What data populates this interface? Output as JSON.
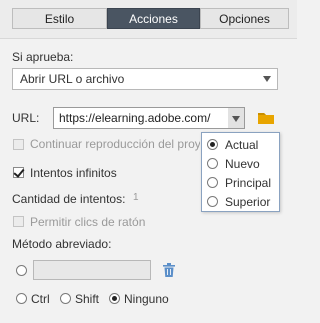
{
  "tabs": [
    {
      "label": "Estilo",
      "active": false
    },
    {
      "label": "Acciones",
      "active": true
    },
    {
      "label": "Opciones",
      "active": false
    }
  ],
  "on_success": {
    "label": "Si aprueba:",
    "selected": "Abrir URL o archivo"
  },
  "url": {
    "label": "URL:",
    "value": "https://elearning.adobe.com/"
  },
  "continue_playback": {
    "label": "Continuar reproducción del proye",
    "checked": false,
    "disabled": true
  },
  "infinite_attempts": {
    "label": "Intentos infinitos",
    "checked": true
  },
  "attempts": {
    "label": "Cantidad de intentos:",
    "value": "1"
  },
  "allow_clicks": {
    "label": "Permitir clics de ratón",
    "checked": false,
    "disabled": true
  },
  "shortcut": {
    "label": "Método abreviado:",
    "modifiers": [
      {
        "label": "Ctrl",
        "selected": false
      },
      {
        "label": "Shift",
        "selected": false
      },
      {
        "label": "Ninguno",
        "selected": true
      }
    ]
  },
  "window_popup": {
    "options": [
      {
        "label": "Actual",
        "selected": true
      },
      {
        "label": "Nuevo",
        "selected": false
      },
      {
        "label": "Principal",
        "selected": false
      },
      {
        "label": "Superior",
        "selected": false
      }
    ]
  },
  "icons": {
    "folder": "folder-icon",
    "trash": "trash-icon"
  },
  "colors": {
    "active_tab": "#4a5562",
    "folder": "#e8a500",
    "trash": "#5b8fc9"
  }
}
